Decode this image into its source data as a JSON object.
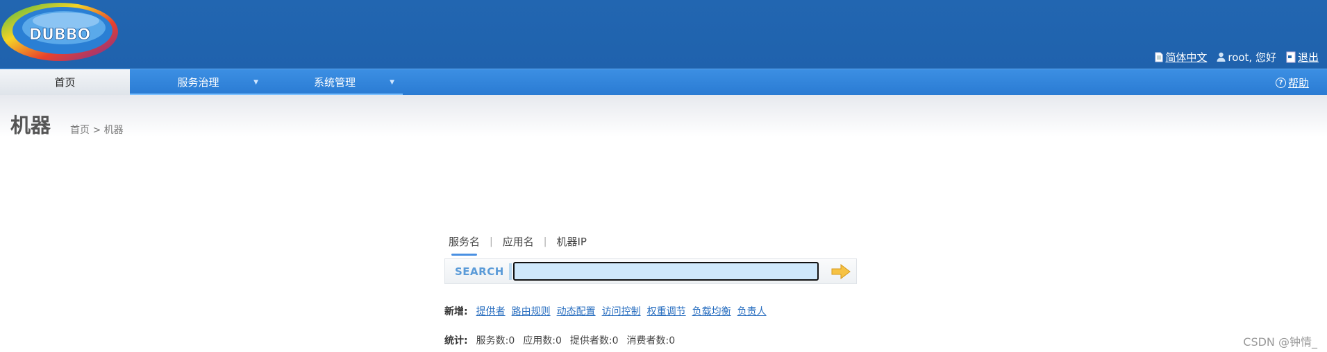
{
  "header": {
    "logo_text": "DUBBO",
    "language_label": "简体中文",
    "greeting": "root, 您好",
    "logout_label": "退出"
  },
  "nav": {
    "items": [
      {
        "label": "首页",
        "active": true
      },
      {
        "label": "服务治理",
        "has_menu": true
      },
      {
        "label": "系统管理",
        "has_menu": true
      }
    ],
    "help_label": "帮助"
  },
  "page": {
    "title": "机器",
    "breadcrumb": "首页 > 机器"
  },
  "search": {
    "tabs": [
      {
        "label": "服务名",
        "active": true
      },
      {
        "label": "应用名"
      },
      {
        "label": "机器IP"
      }
    ],
    "label": "SEARCH",
    "value": "",
    "placeholder": ""
  },
  "add_links": {
    "label": "新增:",
    "items": [
      "提供者",
      "路由规则",
      "动态配置",
      "访问控制",
      "权重调节",
      "负载均衡",
      "负责人"
    ]
  },
  "stats": {
    "label": "统计:",
    "items": [
      "服务数:0",
      "应用数:0",
      "提供者数:0",
      "消费者数:0"
    ]
  },
  "watermark": "CSDN @钟情_",
  "colors": {
    "header_bg": "#2266b1",
    "nav_bg": "#3589dd",
    "link": "#2a6fc0",
    "search_input_bg": "#cfe8fb"
  }
}
